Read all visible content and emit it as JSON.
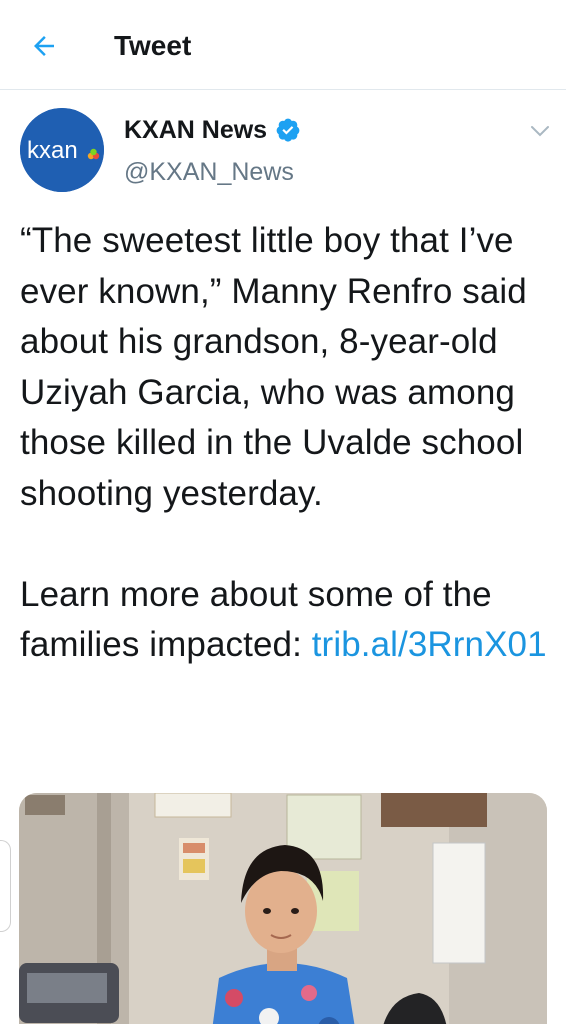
{
  "header": {
    "title": "Tweet"
  },
  "author": {
    "name": "KXAN News",
    "handle": "@KXAN_News",
    "avatar_text": "kxan"
  },
  "tweet": {
    "text_lines_1": "“The sweetest little boy that I’ve ever known,” Manny Renfro said about his grandson, 8-year-old Uziyah Garcia, who was among those killed in the Uvalde school shooting yesterday.",
    "text_2_prefix": "Learn more about some of the families impacted: ",
    "link": "trib.al/3RrnX01"
  },
  "colors": {
    "accent": "#1b95e0",
    "avatar_bg": "#1f5fb2",
    "verified": "#1da1f2"
  },
  "icons": {
    "back": "arrow-left-icon",
    "verified": "verified-badge-icon",
    "more": "chevron-down-icon"
  }
}
